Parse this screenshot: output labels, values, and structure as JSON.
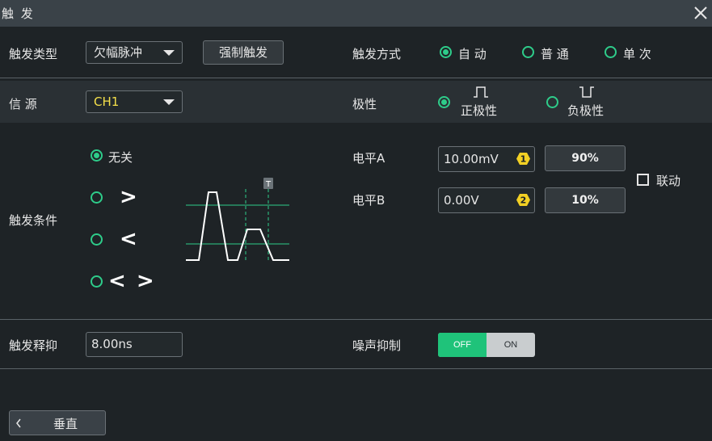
{
  "window": {
    "title": "触 发"
  },
  "trigger_type": {
    "label": "触发类型",
    "value": "欠幅脉冲",
    "force_button": "强制触发"
  },
  "trigger_mode": {
    "label": "触发方式",
    "options": [
      "自 动",
      "普 通",
      "单 次"
    ],
    "selected": 0
  },
  "source": {
    "label": "信 源",
    "value": "CH1"
  },
  "polarity": {
    "label": "极性",
    "options": [
      "正极性",
      "负极性"
    ],
    "selected": 0
  },
  "condition": {
    "label": "触发条件",
    "options": [
      "无关",
      ">",
      "<",
      "< >"
    ],
    "selected": 0,
    "marker": "T"
  },
  "level_a": {
    "label": "电平A",
    "value": "10.00mV",
    "badge": "1",
    "percent": "90%"
  },
  "level_b": {
    "label": "电平B",
    "value": "0.00V",
    "badge": "2",
    "percent": "10%"
  },
  "link": {
    "label": "联动",
    "checked": false
  },
  "holdoff": {
    "label": "触发释抑",
    "value": "8.00ns"
  },
  "noise_reject": {
    "label": "噪声抑制",
    "off_label": "OFF",
    "on_label": "ON",
    "state": "OFF"
  },
  "nav": {
    "back_label": "垂直"
  },
  "colors": {
    "accent": "#2ecc8a",
    "badge": "#f2d024",
    "channel": "#f5e04a",
    "toggle_on": "#1fc37a"
  }
}
